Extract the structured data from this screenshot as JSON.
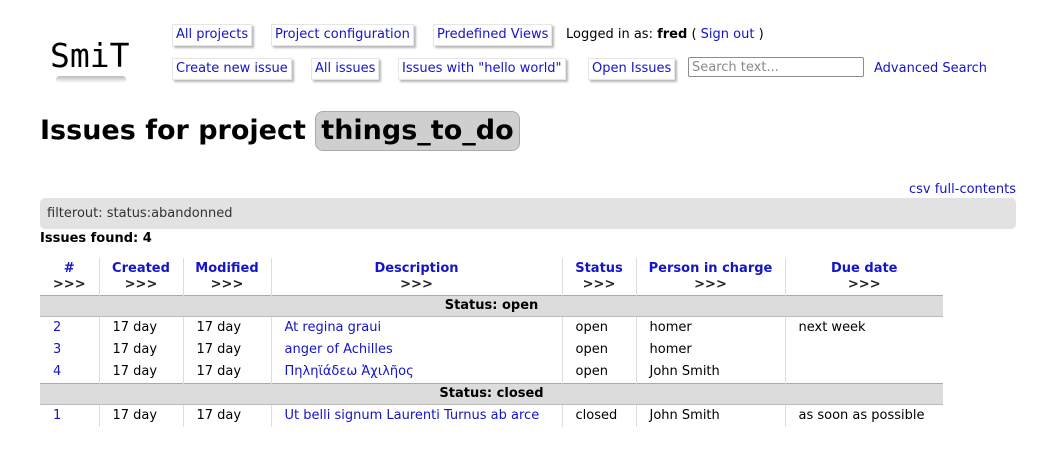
{
  "logo": {
    "text": "SmiT"
  },
  "nav": {
    "all_projects": "All projects",
    "project_configuration": "Project configuration",
    "predefined_views": "Predefined Views",
    "logged_in_prefix": "Logged in as:",
    "username": "fred",
    "paren_open": "(",
    "sign_out": "Sign out",
    "paren_close": ")",
    "create_new_issue": "Create new issue",
    "all_issues": "All issues",
    "issues_hello_world": "Issues with \"hello world\"",
    "open_issues": "Open Issues",
    "search_placeholder": "Search text...",
    "advanced_search": "Advanced Search"
  },
  "page": {
    "title_prefix": "Issues for project",
    "project_name": "things_to_do",
    "csv_link": "csv full-contents",
    "filter_text": "filterout: status:abandonned",
    "issues_found": "Issues found: 4"
  },
  "table": {
    "sort_marker": ">>>",
    "headers": [
      "#",
      "Created",
      "Modified",
      "Description",
      "Status",
      "Person in charge",
      "Due date"
    ],
    "groups": [
      {
        "label": "Status: open",
        "rows": [
          {
            "id": "2",
            "created": "17 day",
            "modified": "17 day",
            "description": "At regina graui",
            "status": "open",
            "person": "homer",
            "due": "next week"
          },
          {
            "id": "3",
            "created": "17 day",
            "modified": "17 day",
            "description": "anger of Achilles",
            "status": "open",
            "person": "homer",
            "due": ""
          },
          {
            "id": "4",
            "created": "17 day",
            "modified": "17 day",
            "description": "Πηληϊάδεω Ἀχιλῆος",
            "status": "open",
            "person": "John Smith",
            "due": ""
          }
        ]
      },
      {
        "label": "Status: closed",
        "rows": [
          {
            "id": "1",
            "created": "17 day",
            "modified": "17 day",
            "description": "Ut belli signum Laurenti Turnus ab arce",
            "status": "closed",
            "person": "John Smith",
            "due": "as soon as possible"
          }
        ]
      }
    ]
  }
}
